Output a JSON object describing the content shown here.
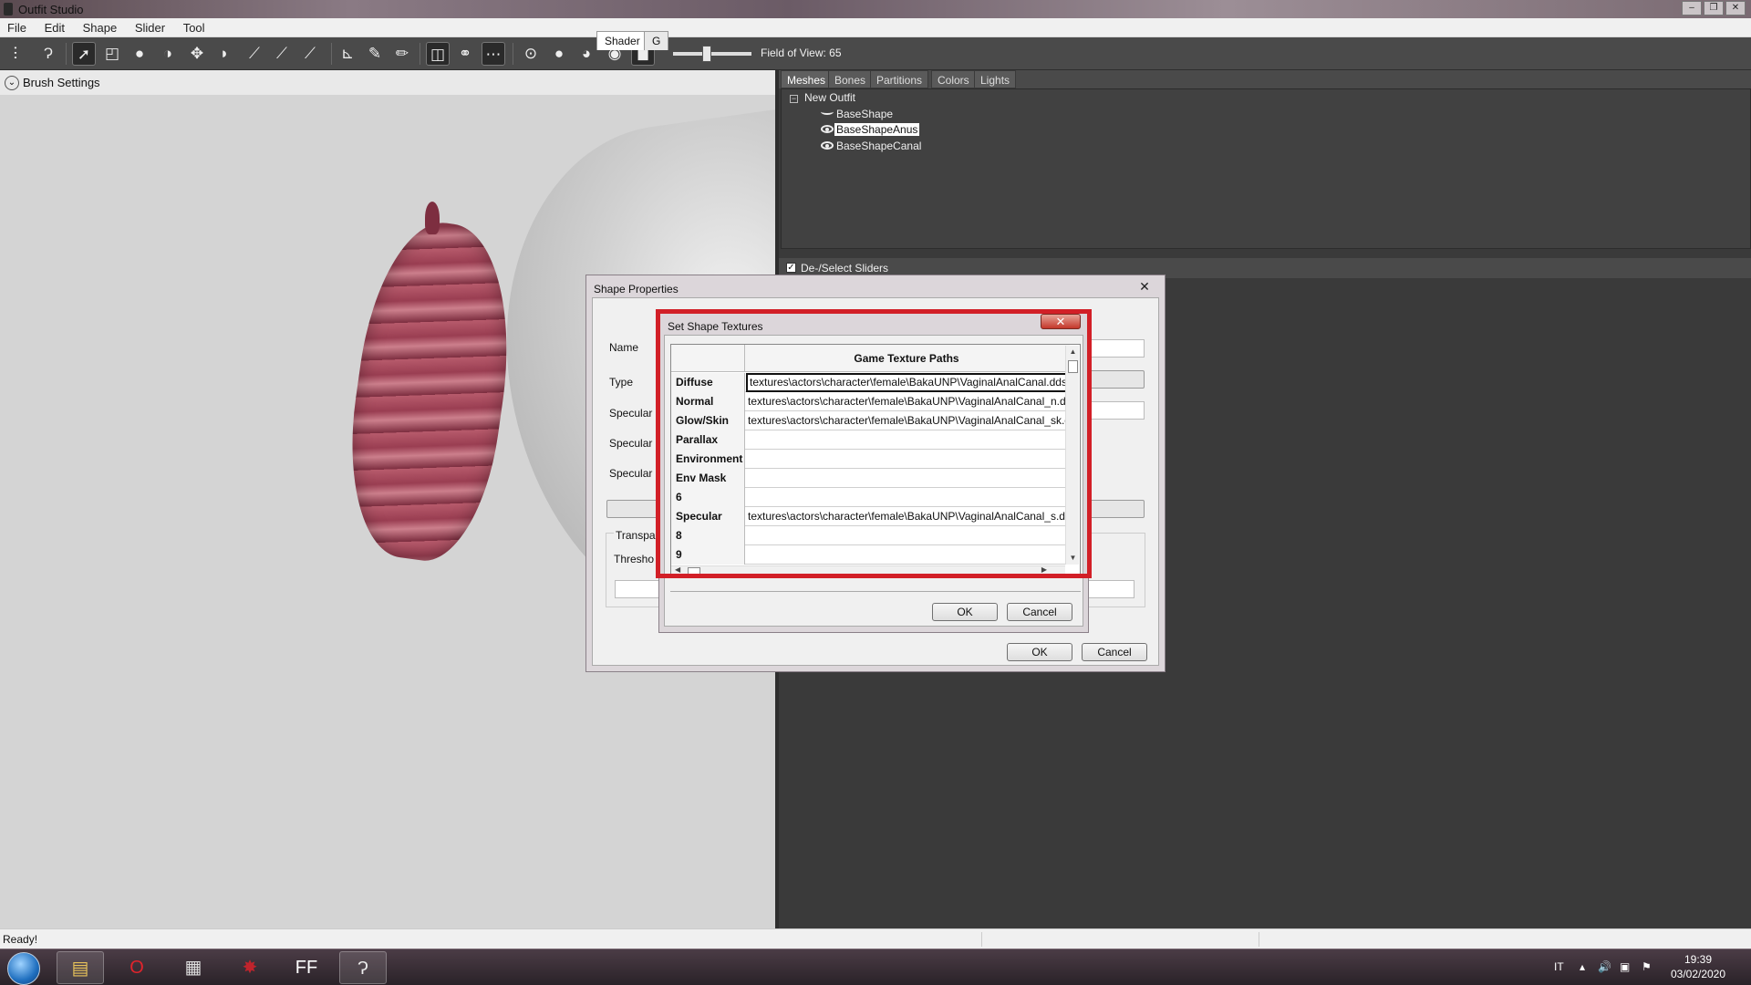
{
  "window": {
    "title": "Outfit Studio",
    "controls": [
      "–",
      "❐",
      "✕"
    ]
  },
  "menu": [
    "File",
    "Edit",
    "Shape",
    "Slider",
    "Tool"
  ],
  "toolbar": {
    "fov_label": "Field of View: 65"
  },
  "brush_settings": {
    "label": "Brush Settings"
  },
  "right_tabs": [
    "Meshes",
    "Bones",
    "Partitions",
    "Colors",
    "Lights"
  ],
  "mesh_tree": {
    "root": "New Outfit",
    "items": [
      "BaseShape",
      "BaseShapeAnus",
      "BaseShapeCanal"
    ],
    "selected": "BaseShapeAnus"
  },
  "sliders": {
    "toggle_label": "De-/Select Sliders",
    "checked": true
  },
  "status": {
    "text": "Ready!"
  },
  "shape_properties": {
    "title": "Shape Properties",
    "tabs": [
      "Shader",
      "G"
    ],
    "labels": {
      "name": "Name",
      "type": "Type",
      "specular1": "Specular",
      "specular2": "Specular",
      "specular3": "Specular",
      "transparency": "Transpa",
      "threshold": "Thresho"
    },
    "ok": "OK",
    "cancel": "Cancel"
  },
  "set_shape_textures": {
    "title": "Set Shape Textures",
    "header": "Game Texture Paths",
    "rows": [
      {
        "label": "Diffuse",
        "value": "textures\\actors\\character\\female\\BakaUNP\\VaginalAnalCanal.dds"
      },
      {
        "label": "Normal",
        "value": "textures\\actors\\character\\female\\BakaUNP\\VaginalAnalCanal_n.d"
      },
      {
        "label": "Glow/Skin",
        "value": "textures\\actors\\character\\female\\BakaUNP\\VaginalAnalCanal_sk.d"
      },
      {
        "label": "Parallax",
        "value": ""
      },
      {
        "label": "Environment",
        "value": ""
      },
      {
        "label": "Env Mask",
        "value": ""
      },
      {
        "label": "6",
        "value": ""
      },
      {
        "label": "Specular",
        "value": "textures\\actors\\character\\female\\BakaUNP\\VaginalAnalCanal_s.d"
      },
      {
        "label": "8",
        "value": ""
      },
      {
        "label": "9",
        "value": ""
      }
    ],
    "ok": "OK",
    "cancel": "Cancel"
  },
  "taskbar": {
    "apps": [
      "Explorer",
      "Opera",
      "Media",
      "Outfit Studio mesh",
      "FFdec",
      "Outfit Studio"
    ],
    "tray_lang": "IT",
    "time": "19:39",
    "date": "03/02/2020"
  },
  "colors": {
    "highlight_red": "#d21f27",
    "dark_panel": "#414141"
  }
}
